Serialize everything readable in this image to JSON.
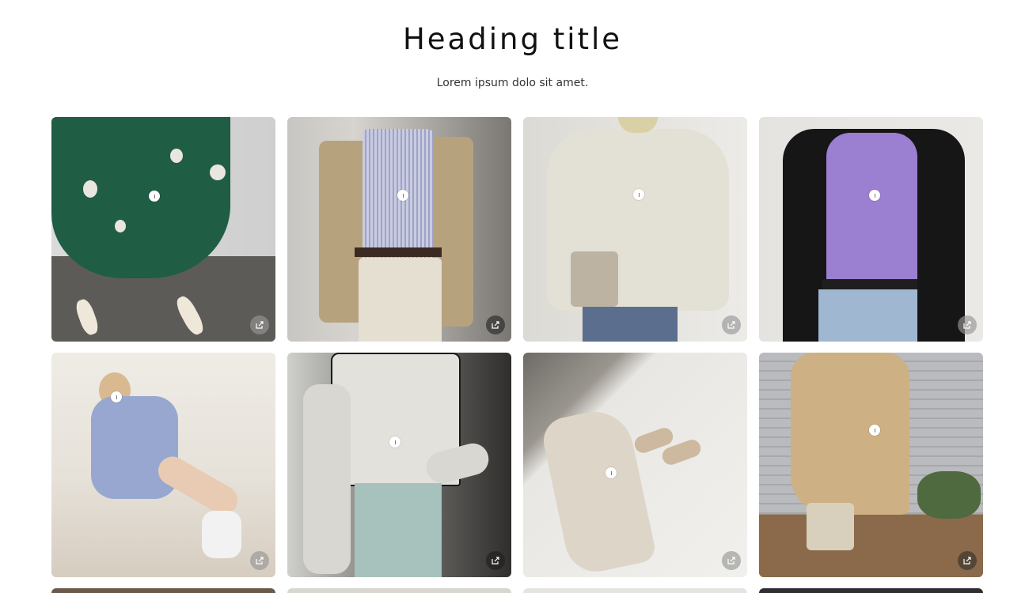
{
  "header": {
    "title": "Heading title",
    "subtitle": "Lorem ipsum dolo sit amet."
  },
  "gallery": {
    "items": [
      {
        "photo": "green floral midi skirt with white mules",
        "icon": "share-icon"
      },
      {
        "photo": "striped shirt with beige blazer and brown belt",
        "icon": "share-icon"
      },
      {
        "photo": "cream knit sweater with taupe crossbody bag",
        "icon": "share-icon"
      },
      {
        "photo": "lavender tee with black blazer and jeans",
        "icon": "share-icon"
      },
      {
        "photo": "blue striped pajama set with white socks",
        "icon": "share-icon"
      },
      {
        "photo": "white cardigan with light jeans",
        "icon": "share-icon"
      },
      {
        "photo": "silk slip dress and mules flat lay",
        "icon": "share-icon"
      },
      {
        "photo": "beige trench coat on wooden deck",
        "icon": "share-icon"
      }
    ]
  },
  "colors": {
    "text": "#111111",
    "share_button_bg": "#969696",
    "hotspot": "#ffffff"
  }
}
